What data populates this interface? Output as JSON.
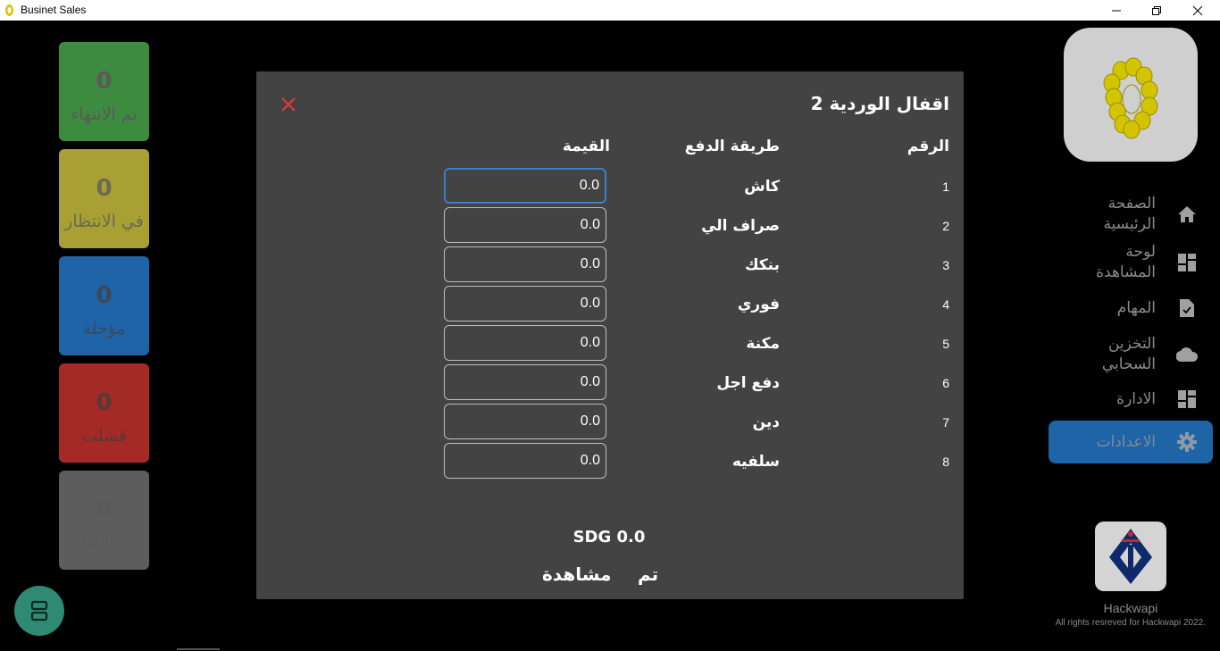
{
  "window": {
    "title": "Businet Sales"
  },
  "status_cards": [
    {
      "count": "0",
      "label": "تم الانتهاء",
      "color": "#3d8b3f"
    },
    {
      "count": "0",
      "label": "في الانتظار",
      "color": "#a9a033"
    },
    {
      "count": "0",
      "label": "مؤجلة",
      "color": "#1f64a6"
    },
    {
      "count": "0",
      "label": "فشلت",
      "color": "#a52a26"
    },
    {
      "count": "0",
      "label": "تم الالغاء",
      "color": "#5d5d5d"
    }
  ],
  "nav": {
    "items": [
      {
        "label": "الصفحة الرئيسية",
        "icon": "home-icon"
      },
      {
        "label": "لوحة المشاهدة",
        "icon": "dashboard-icon"
      },
      {
        "label": "المهام",
        "icon": "task-icon"
      },
      {
        "label": "التخزين السحابي",
        "icon": "cloud-icon"
      },
      {
        "label": "الادارة",
        "icon": "dashboard-icon"
      },
      {
        "label": "الاعدادات",
        "icon": "gear-icon",
        "active": true
      }
    ]
  },
  "footer": {
    "company": "Hackwapi",
    "copyright": "All rights resreved for Hackwapi 2022."
  },
  "dialog": {
    "title": "اقفال الوردية 2",
    "headers": {
      "number": "الرقم",
      "method": "طريقة الدفع",
      "value": "القيمة"
    },
    "rows": [
      {
        "number": "1",
        "method": "كاش",
        "value": "0.0"
      },
      {
        "number": "2",
        "method": "صراف الي",
        "value": "0.0"
      },
      {
        "number": "3",
        "method": "بنكك",
        "value": "0.0"
      },
      {
        "number": "4",
        "method": "فوري",
        "value": "0.0"
      },
      {
        "number": "5",
        "method": "مكنة",
        "value": "0.0"
      },
      {
        "number": "6",
        "method": "دفع اجل",
        "value": "0.0"
      },
      {
        "number": "7",
        "method": "دين",
        "value": "0.0"
      },
      {
        "number": "8",
        "method": "سلفيه",
        "value": "0.0"
      }
    ],
    "total": "SDG 0.0",
    "view_label": "مشاهدة",
    "done_label": "تم"
  },
  "colors": {
    "accent": "#1f64a6",
    "close_x": "#e53935",
    "dialog_bg": "#434343",
    "fab": "#2e8a72"
  }
}
